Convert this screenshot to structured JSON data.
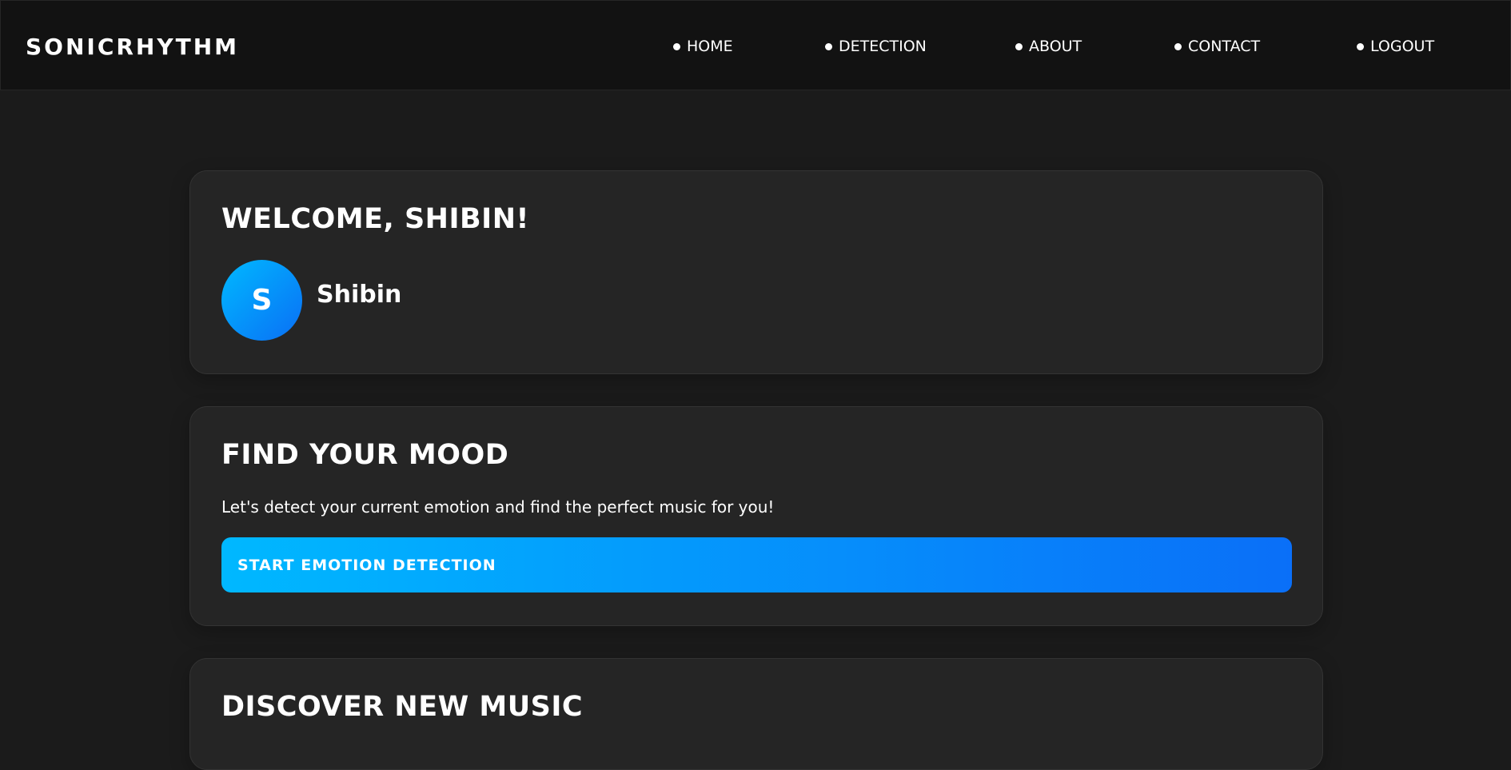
{
  "brand": {
    "name": "SONICRHYTHM"
  },
  "nav": {
    "items": [
      {
        "label": "HOME"
      },
      {
        "label": "DETECTION"
      },
      {
        "label": "ABOUT"
      },
      {
        "label": "CONTACT"
      },
      {
        "label": "LOGOUT"
      }
    ]
  },
  "welcome": {
    "title": "WELCOME, SHIBIN!",
    "avatar_initial": "S",
    "username": "Shibin"
  },
  "mood": {
    "title": "FIND YOUR MOOD",
    "description": "Let's detect your current emotion and find the perfect music for you!",
    "button_label": "START EMOTION DETECTION"
  },
  "discover": {
    "title": "DISCOVER NEW MUSIC"
  },
  "colors": {
    "background": "#1b1b1b",
    "navbar": "#121212",
    "card": "#252525",
    "accent_start": "#00b8ff",
    "accent_end": "#0a6ff8"
  }
}
